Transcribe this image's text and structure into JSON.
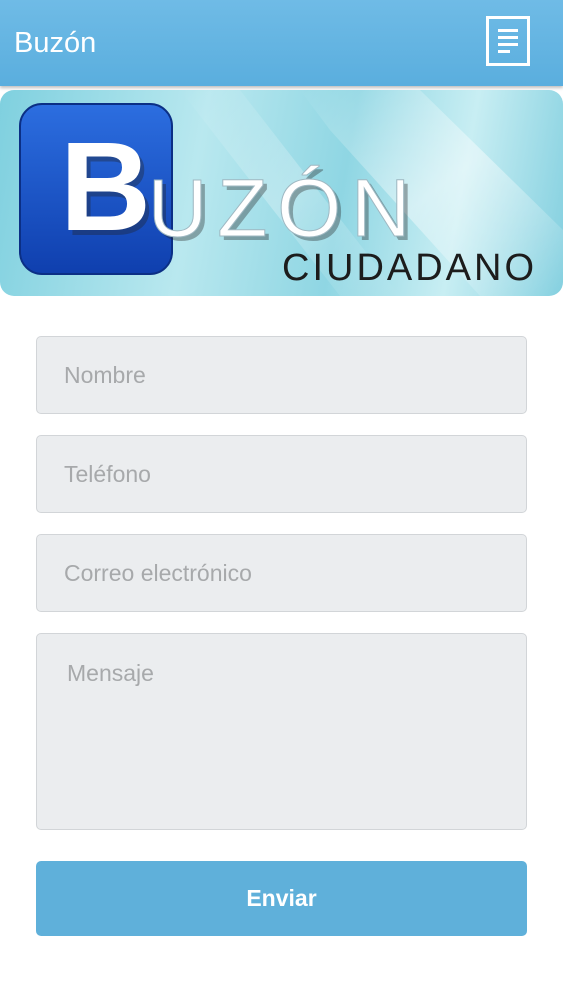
{
  "header": {
    "title": "Buzón",
    "menu_icon": "menu-list-icon"
  },
  "banner": {
    "logo_letter": "B",
    "logo_word_rest": "UZÓN",
    "logo_subtitle": "CIUDADANO",
    "colors": {
      "badge": "#1a52c8",
      "background": "#a9e1ea"
    }
  },
  "form": {
    "name_placeholder": "Nombre",
    "phone_placeholder": "Teléfono",
    "email_placeholder": "Correo electrónico",
    "message_placeholder": "Mensaje",
    "submit_label": "Enviar"
  },
  "colors": {
    "accent": "#5fb0da",
    "header": "#63b4e1",
    "field_background": "#ebedef"
  }
}
